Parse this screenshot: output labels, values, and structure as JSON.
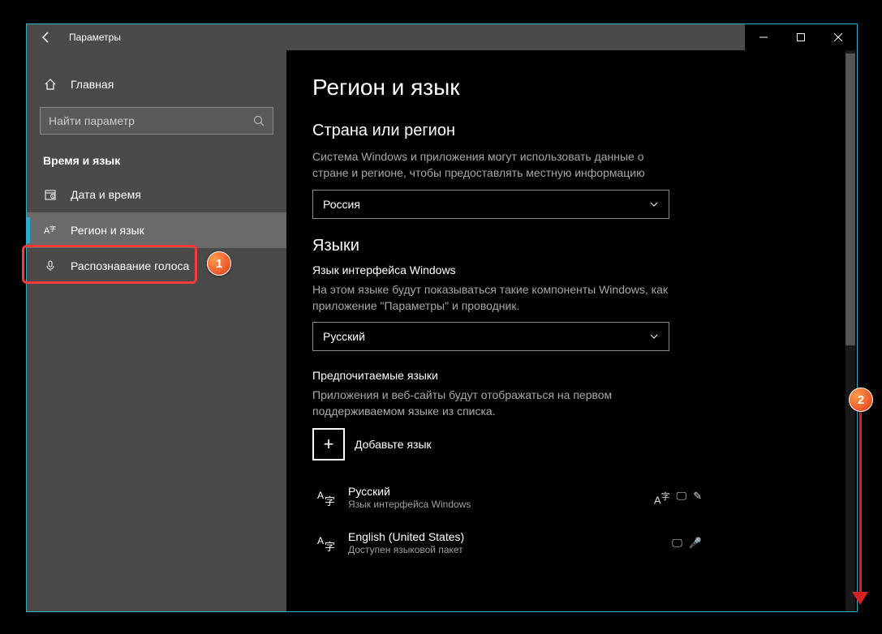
{
  "window": {
    "title": "Параметры"
  },
  "sidebar": {
    "home": "Главная",
    "search_placeholder": "Найти параметр",
    "category": "Время и язык",
    "items": [
      {
        "label": "Дата и время"
      },
      {
        "label": "Регион и язык"
      },
      {
        "label": "Распознавание голоса"
      }
    ]
  },
  "main": {
    "title": "Регион и язык",
    "region_header": "Страна или регион",
    "region_desc": "Система Windows и приложения могут использовать данные о стране и регионе, чтобы предоставлять местную информацию",
    "region_value": "Россия",
    "languages_header": "Языки",
    "ui_lang_label": "Язык интерфейса Windows",
    "ui_lang_desc": "На этом языке будут показываться такие компоненты Windows, как приложение \"Параметры\" и проводник.",
    "ui_lang_value": "Русский",
    "pref_header": "Предпочитаемые языки",
    "pref_desc": "Приложения и веб-сайты будут отображаться на первом поддерживаемом языке из списка.",
    "add_lang": "Добавьте язык",
    "langs": [
      {
        "name": "Русский",
        "status": "Язык интерфейса Windows"
      },
      {
        "name": "English (United States)",
        "status": "Доступен языковой пакет"
      }
    ]
  },
  "annotations": {
    "badge1": "1",
    "badge2": "2"
  }
}
